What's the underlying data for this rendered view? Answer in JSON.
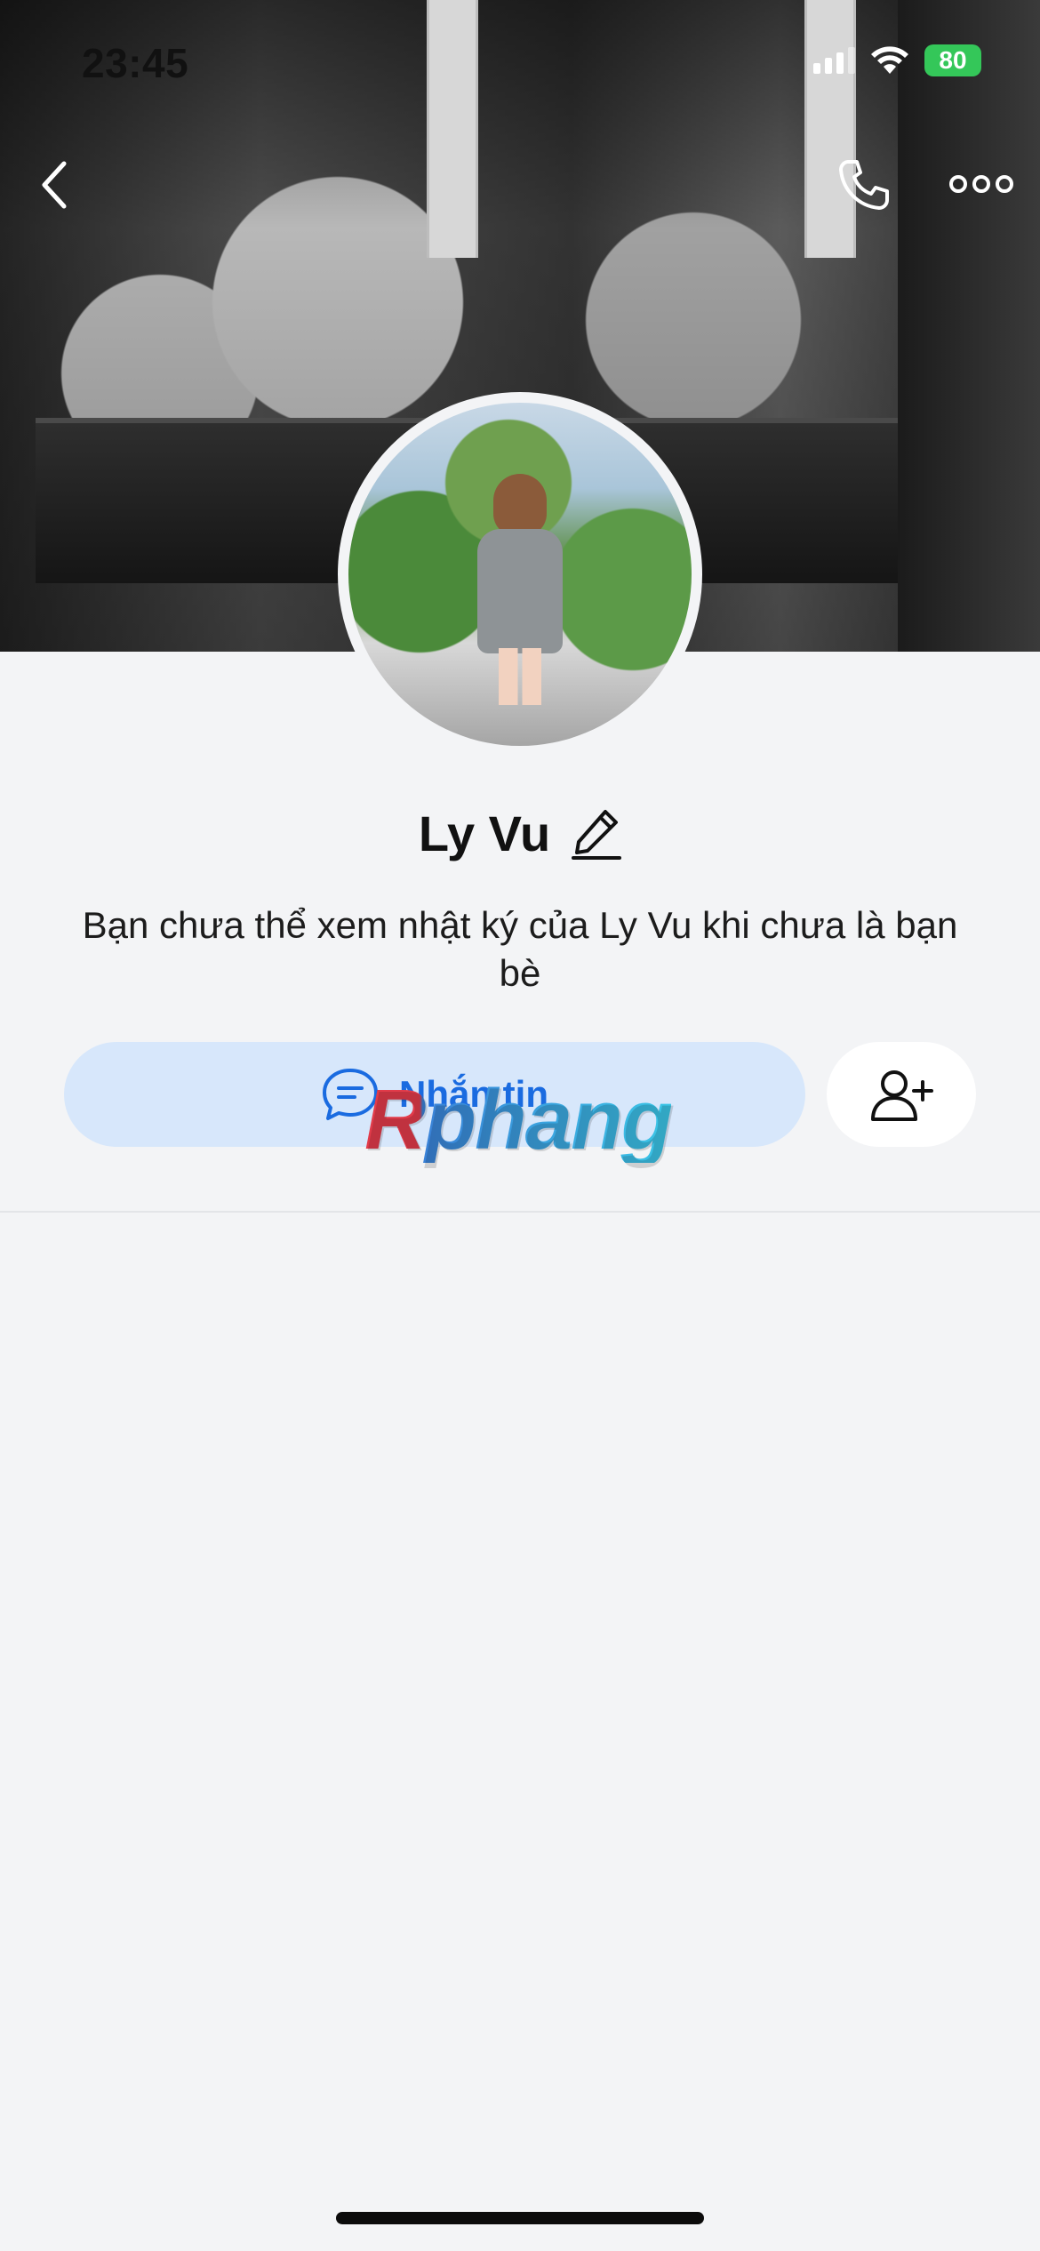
{
  "status_bar": {
    "time": "23:45",
    "battery": "80"
  },
  "icons": {
    "back": "chevron-left-icon",
    "call": "phone-icon",
    "more": "more-horizontal-icon",
    "edit": "pencil-icon",
    "chat": "chat-bubble-icon",
    "add_friend": "add-user-icon"
  },
  "profile": {
    "name": "Ly Vu",
    "privacy_notice": "Bạn chưa thể xem nhật ký của Ly Vu khi chưa là bạn bè"
  },
  "actions": {
    "message_label": "Nhắn tin"
  },
  "watermark": {
    "text": "Rphang"
  },
  "colors": {
    "message_button_bg": "#d7e7fb",
    "message_button_text": "#1a6be0",
    "battery": "#34c759",
    "page_bg": "#f3f4f6"
  }
}
